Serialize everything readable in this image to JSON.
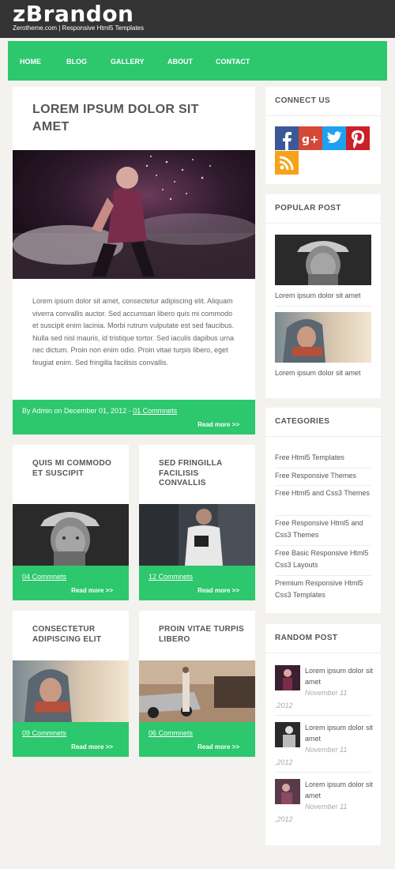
{
  "header": {
    "logo": "zBrandon",
    "tagline": "Zerotheme.com | Responsive Html5 Templates"
  },
  "nav": [
    "HOME",
    "BLOG",
    "GALLERY",
    "ABOUT",
    "CONTACT"
  ],
  "main_post": {
    "title": "LOREM IPSUM DOLOR SIT AMET",
    "body": "Lorem ipsum dolor sit amet, consectetur adipiscing elit. Aliquam viverra convallis auctor. Sed accumsan libero quis mi commodo et suscipit enim lacinia. Morbi rutrum vulputate est sed faucibus. Nulla sed nisl mauris, id tristique tortor. Sed iaculis dapibus urna nec dictum. Proin non enim odio. Proin vitae turpis libero, eget feugiat enim. Sed fringilla facilisis convallis.",
    "meta_prefix": "By Admin on December 01, 2012 - ",
    "comments": "01 Commnets",
    "read_more": "Read more >>"
  },
  "cards": [
    {
      "title": "QUIS MI COMMODO ET SUSCIPIT",
      "comments": "04 Commnets",
      "read_more": "Read more >>"
    },
    {
      "title": "SED FRINGILLA FACILISIS CONVALLIS",
      "comments": "12 Commnets",
      "read_more": "Read more >>"
    },
    {
      "title": "CONSECTETUR ADIPISCING ELIT",
      "comments": "09 Commnets",
      "read_more": "Read more >>"
    },
    {
      "title": "PROIN VITAE TURPIS LIBERO",
      "comments": "06 Commnets",
      "read_more": "Read more >>"
    }
  ],
  "sidebar": {
    "connect": {
      "title": "CONNECT US",
      "icons": [
        "facebook-icon",
        "google-plus-icon",
        "twitter-icon",
        "pinterest-icon",
        "rss-icon"
      ]
    },
    "popular": {
      "title": "POPULAR POST",
      "items": [
        "Lorem ipsum dolor sit amet",
        "Lorem ipsum dolor sit amet"
      ]
    },
    "categories": {
      "title": "CATEGORIES",
      "items": [
        "Free Html5 Templates",
        "Free Responsive Themes",
        "Free Html5 and Css3 Themes",
        "Free Responsive Html5 and Css3 Themes",
        "Free Basic Responsive Html5 Css3 Layouts",
        "Premium Responsive Html5 Css3 Templates"
      ]
    },
    "random": {
      "title": "RANDOM POST",
      "items": [
        {
          "title": "Lorem ipsum dolor sit amet",
          "date": "November 11",
          "year": ",2012"
        },
        {
          "title": "Lorem ipsum dolor sit amet",
          "date": "November 11",
          "year": ",2012"
        },
        {
          "title": "Lorem ipsum dolor sit amet",
          "date": "November 11",
          "year": ",2012"
        }
      ]
    }
  },
  "colors": {
    "accent": "#2dc76d",
    "header_bg": "#333333",
    "page_bg": "#f3f2ee"
  }
}
